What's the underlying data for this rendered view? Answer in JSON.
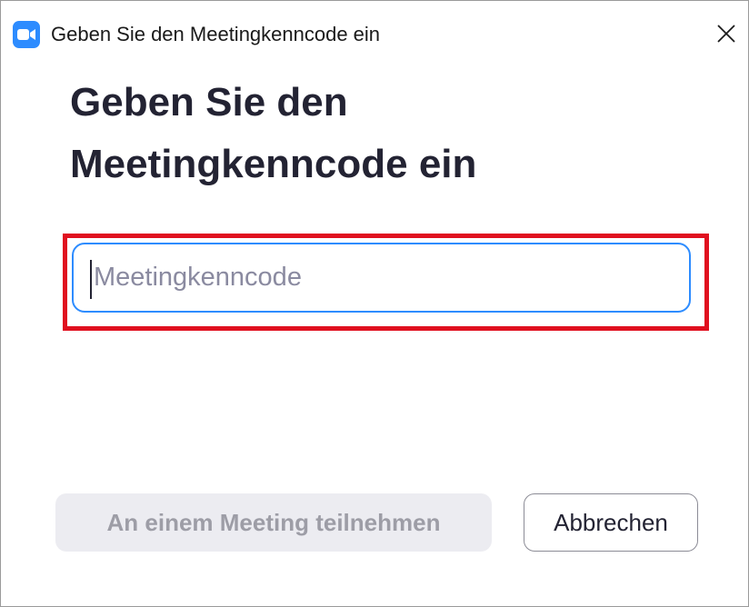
{
  "window": {
    "title": "Geben Sie den Meetingkenncode ein"
  },
  "app_icon": "zoom-camera-icon",
  "close_icon": "close-icon",
  "heading": {
    "line1": "Geben Sie den",
    "line2": "Meetingkenncode ein"
  },
  "passcode": {
    "value": "",
    "placeholder": "Meetingkenncode",
    "focused": true,
    "highlighted": true
  },
  "buttons": {
    "join_label": "An einem Meeting teilnehmen",
    "join_enabled": false,
    "cancel_label": "Abbrechen"
  },
  "colors": {
    "accent": "#2d8cff",
    "highlight": "#e0101f",
    "heading_text": "#232333",
    "disabled_bg": "#ececf1",
    "disabled_text": "#9d9da6"
  }
}
